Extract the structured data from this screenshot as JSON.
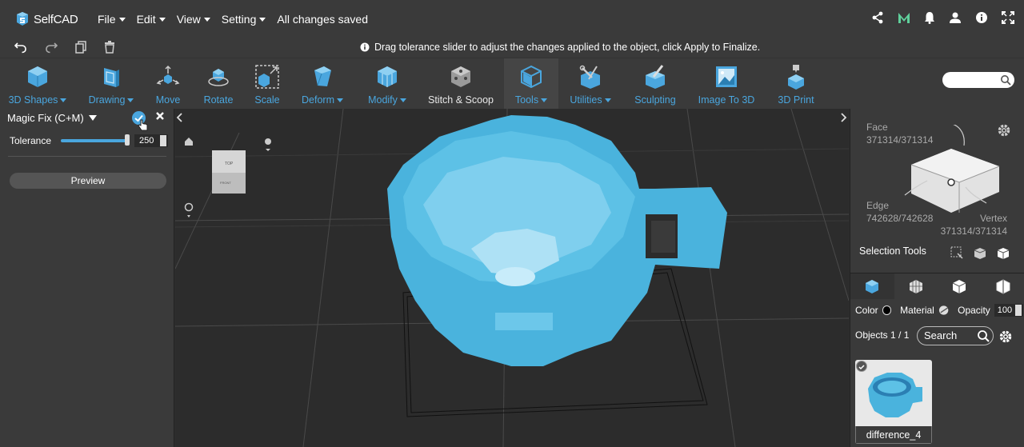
{
  "app": {
    "logo_text": "SelfCAD",
    "menu": [
      {
        "label": "File"
      },
      {
        "label": "Edit"
      },
      {
        "label": "View"
      },
      {
        "label": "Setting"
      }
    ],
    "save_status": "All changes saved"
  },
  "hint": "Drag tolerance slider to adjust the changes applied to the object, click Apply to Finalize.",
  "toolbar": {
    "tools": [
      {
        "label": "3D Shapes",
        "icon": "cube-icon"
      },
      {
        "label": "Drawing",
        "icon": "drawing-icon"
      },
      {
        "label": "Move",
        "icon": "move-icon"
      },
      {
        "label": "Rotate",
        "icon": "rotate-icon"
      },
      {
        "label": "Scale",
        "icon": "scale-icon"
      },
      {
        "label": "Deform",
        "icon": "deform-icon"
      },
      {
        "label": "Modify",
        "icon": "modify-icon"
      },
      {
        "label": "Stitch & Scoop",
        "icon": "stitch-scoop-icon"
      },
      {
        "label": "Tools",
        "icon": "tools-icon"
      },
      {
        "label": "Utilities",
        "icon": "utilities-icon"
      },
      {
        "label": "Sculpting",
        "icon": "sculpting-icon"
      },
      {
        "label": "Image To 3D",
        "icon": "image-to-3d-icon"
      },
      {
        "label": "3D Print",
        "icon": "3d-print-icon"
      }
    ],
    "search_placeholder": ""
  },
  "left_panel": {
    "title": "Magic Fix (C+M)",
    "tolerance_label": "Tolerance",
    "tolerance_value": "250",
    "tolerance_level": 1.0,
    "preview_label": "Preview"
  },
  "viewcube": {
    "top_label": "TOP",
    "front_label": "FRONT"
  },
  "right_panel": {
    "face_label": "Face",
    "face_count": "371314/371314",
    "edge_label": "Edge",
    "edge_count": "742628/742628",
    "vertex_label": "Vertex",
    "vertex_count": "371314/371314",
    "selection_tools": "Selection Tools",
    "color_label": "Color",
    "material_label": "Material",
    "opacity_label": "Opacity",
    "opacity_value": "100",
    "objects_label": "Objects 1 / 1",
    "search_label": "Search",
    "object_name": "difference_4"
  },
  "colors": {
    "accent": "#4aa6de",
    "model": "#4db8e0",
    "panel": "#3a3a3a",
    "viewport": "#2c2c2c"
  }
}
